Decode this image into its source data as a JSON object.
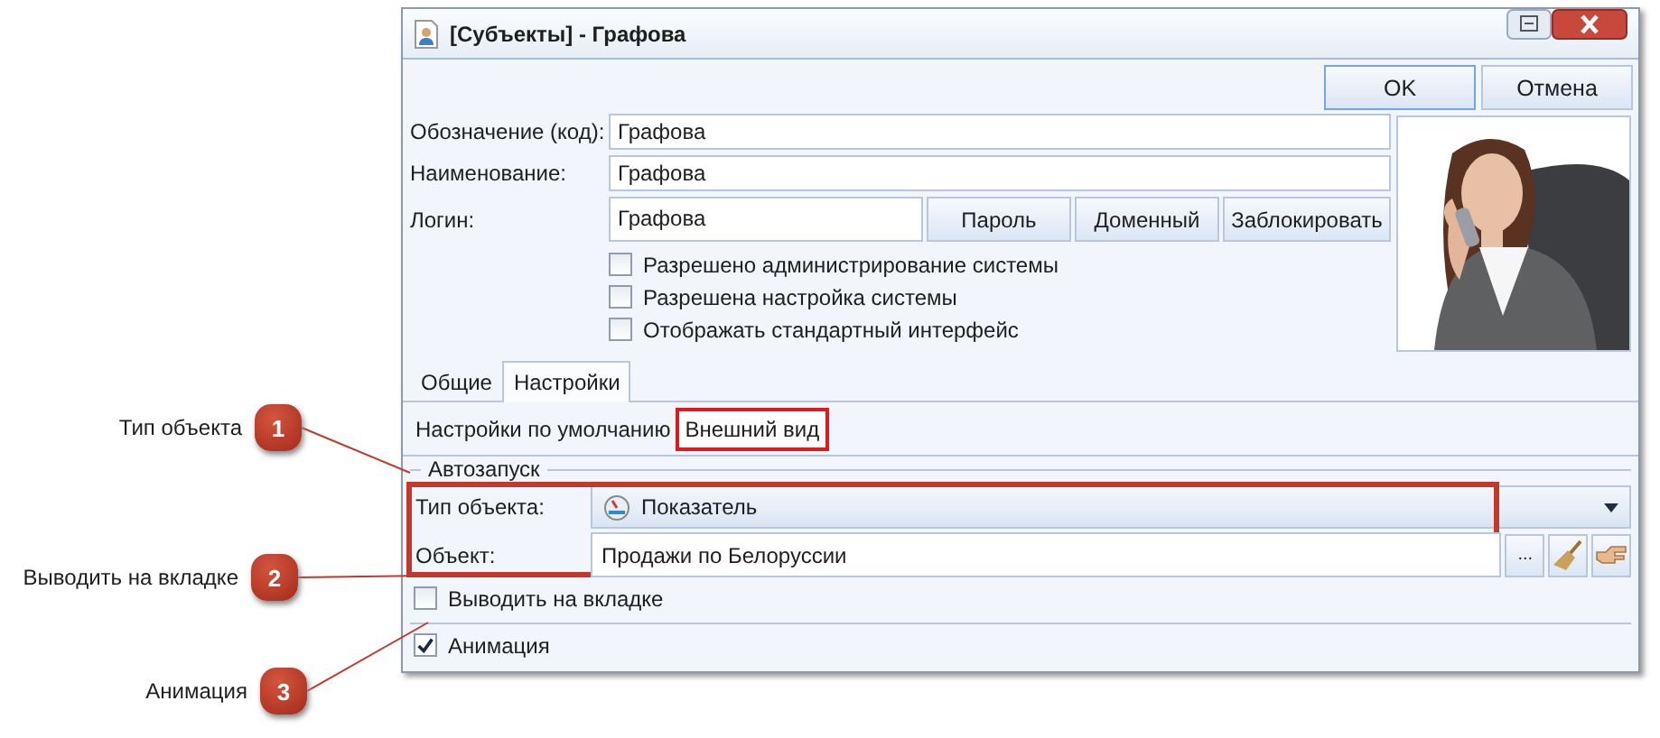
{
  "window": {
    "title": "[Субъекты] - Графова"
  },
  "dialog_buttons": [
    {
      "label": "OK",
      "selected": true
    },
    {
      "label": "Отмена",
      "selected": false
    }
  ],
  "fields": [
    {
      "label": "Обозначение (код):",
      "value": "Графова"
    },
    {
      "label": "Наименование:",
      "value": "Графова"
    },
    {
      "label": "Логин:",
      "value": "Графова"
    }
  ],
  "login_buttons": [
    "Пароль",
    "Доменный",
    "Заблокировать"
  ],
  "checkboxes": [
    {
      "label": "Разрешено администрирование системы",
      "checked": false
    },
    {
      "label": "Разрешена настройка системы",
      "checked": false
    },
    {
      "label": "Отображать стандартный интерфейс",
      "checked": false
    }
  ],
  "tabs": [
    {
      "label": "Общие",
      "selected": false
    },
    {
      "label": "Настройки",
      "selected": true
    }
  ],
  "subtabs": [
    {
      "label": "Настройки по умолчанию",
      "selected": false,
      "highlighted": false
    },
    {
      "label": "Внешний вид",
      "selected": true,
      "highlighted": true
    }
  ],
  "autostart": {
    "legend": "Автозапуск",
    "highlighted": true,
    "object_type": {
      "label": "Тип объекта:",
      "value": "Показатель"
    },
    "object": {
      "label": "Объект:",
      "value": "Продажи по Белоруссии",
      "browse": "..."
    }
  },
  "options": [
    {
      "label": "Выводить на вкладке",
      "checked": false
    },
    {
      "label": "Анимация",
      "checked": true
    }
  ],
  "callouts": [
    {
      "number": "1",
      "label": "Тип объекта"
    },
    {
      "number": "2",
      "label": "Выводить на вкладке"
    },
    {
      "number": "3",
      "label": "Анимация"
    }
  ]
}
